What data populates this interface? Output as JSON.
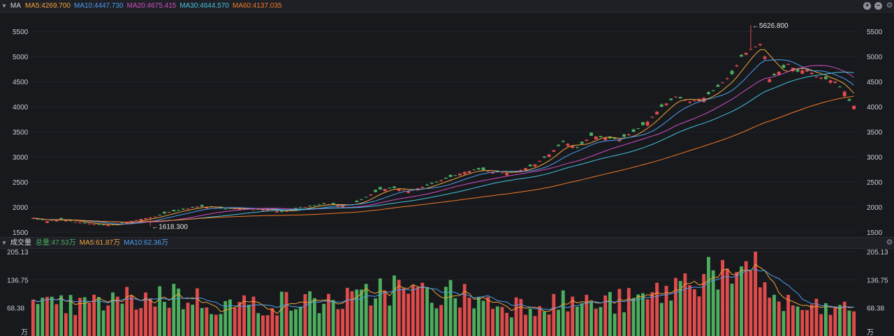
{
  "price_header": {
    "title": "MA",
    "ma5": "MA5:4269.700",
    "ma10": "MA10:4447.730",
    "ma20": "MA20:4675.415",
    "ma30": "MA30:4644.570",
    "ma60": "MA60:4137.035"
  },
  "volume_header": {
    "title": "成交量",
    "total": "总量:47.53万",
    "ma5": "MA5:61.87万",
    "ma10": "MA10:62.36万"
  },
  "icons": [
    "collapse-triangle-icon",
    "zoom-in-icon",
    "zoom-out-icon",
    "gear-icon"
  ],
  "colors": {
    "up": "#e04b4b",
    "down": "#4cae5e",
    "ma5": "#f0a53a",
    "ma10": "#4c9ef0",
    "ma20": "#d04fc4",
    "ma30": "#44c4dc",
    "ma60": "#f07a28",
    "vol_total": "#4cae5e",
    "vol_ma5": "#f0a53a",
    "vol_ma10": "#4c9ef0"
  },
  "chart_data": [
    {
      "type": "candlestick",
      "y_ticks_left": [
        "5500",
        "5000",
        "4500",
        "4000",
        "3500",
        "3000",
        "2500",
        "2000",
        "1500"
      ],
      "y_ticks_right": [
        "5500",
        "5000",
        "4500",
        "4000",
        "3500",
        "3000",
        "2500",
        "2000",
        "1500"
      ],
      "ylim": [
        1430,
        5850
      ],
      "high_marker": "←5626.800",
      "low_marker": "←1618.300",
      "high_value": 5626.8,
      "low_value": 1618.3,
      "close_path": [
        [
          0,
          1780
        ],
        [
          3,
          1720
        ],
        [
          6,
          1760
        ],
        [
          9,
          1700
        ],
        [
          13,
          1660
        ],
        [
          17,
          1640
        ],
        [
          20,
          1700
        ],
        [
          23,
          1760
        ],
        [
          26,
          1810
        ],
        [
          29,
          1900
        ],
        [
          32,
          1950
        ],
        [
          35,
          2010
        ],
        [
          38,
          2000
        ],
        [
          41,
          1960
        ],
        [
          44,
          1980
        ],
        [
          47,
          1950
        ],
        [
          50,
          1960
        ],
        [
          53,
          1900
        ],
        [
          56,
          1960
        ],
        [
          59,
          2020
        ],
        [
          62,
          2060
        ],
        [
          65,
          2040
        ],
        [
          68,
          2050
        ],
        [
          71,
          2200
        ],
        [
          74,
          2350
        ],
        [
          77,
          2380
        ],
        [
          80,
          2320
        ],
        [
          83,
          2400
        ],
        [
          86,
          2500
        ],
        [
          89,
          2600
        ],
        [
          92,
          2700
        ],
        [
          95,
          2750
        ],
        [
          98,
          2700
        ],
        [
          101,
          2680
        ],
        [
          104,
          2740
        ],
        [
          107,
          2850
        ],
        [
          110,
          3050
        ],
        [
          113,
          3300
        ],
        [
          116,
          3180
        ],
        [
          119,
          3420
        ],
        [
          122,
          3380
        ],
        [
          125,
          3350
        ],
        [
          128,
          3500
        ],
        [
          131,
          3700
        ],
        [
          134,
          4000
        ],
        [
          137,
          4200
        ],
        [
          140,
          4100
        ],
        [
          143,
          4180
        ],
        [
          146,
          4400
        ],
        [
          149,
          4650
        ],
        [
          151,
          5000
        ],
        [
          153,
          5150
        ],
        [
          155,
          5250
        ],
        [
          156,
          5000
        ],
        [
          157,
          4550
        ],
        [
          159,
          4700
        ],
        [
          161,
          4850
        ],
        [
          163,
          4700
        ],
        [
          165,
          4750
        ],
        [
          167,
          4600
        ],
        [
          169,
          4550
        ],
        [
          171,
          4500
        ],
        [
          173,
          4300
        ],
        [
          174,
          4120
        ],
        [
          175,
          4020
        ]
      ],
      "candle_count": 176
    },
    {
      "type": "bar",
      "name": "成交量",
      "y_ticks_left": [
        "205.13",
        "136.75",
        "68.38",
        "万"
      ],
      "y_ticks_right": [
        "205.13",
        "136.75",
        "68.38",
        "万"
      ],
      "ylim": [
        0,
        205.13
      ],
      "volume_path": [
        [
          0,
          75
        ],
        [
          10,
          80
        ],
        [
          20,
          95
        ],
        [
          30,
          110
        ],
        [
          40,
          80
        ],
        [
          50,
          85
        ],
        [
          60,
          90
        ],
        [
          70,
          95
        ],
        [
          75,
          135
        ],
        [
          80,
          110
        ],
        [
          90,
          110
        ],
        [
          100,
          80
        ],
        [
          110,
          90
        ],
        [
          120,
          85
        ],
        [
          130,
          95
        ],
        [
          140,
          145
        ],
        [
          145,
          190
        ],
        [
          150,
          120
        ],
        [
          154,
          190
        ],
        [
          158,
          90
        ],
        [
          165,
          70
        ],
        [
          175,
          70
        ]
      ],
      "bar_count": 176
    }
  ]
}
